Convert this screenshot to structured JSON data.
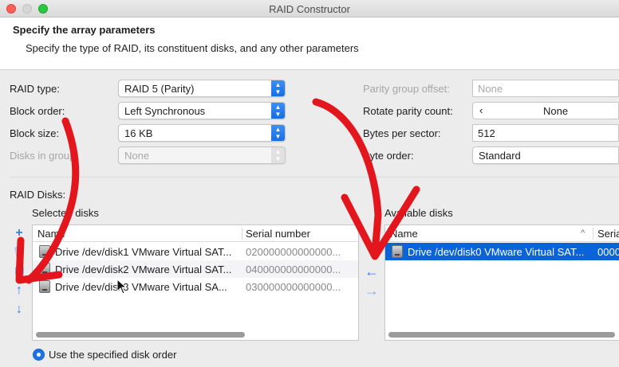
{
  "window": {
    "title": "RAID Constructor"
  },
  "header": {
    "title": "Specify the array parameters",
    "subtitle": "Specify the type of RAID, its constituent disks, and any other parameters"
  },
  "left_params": {
    "raid_type": {
      "label": "RAID type:",
      "value": "RAID 5 (Parity)"
    },
    "block_order": {
      "label": "Block order:",
      "value": "Left Synchronous"
    },
    "block_size": {
      "label": "Block size:",
      "value": "16 KB"
    },
    "disks_in_group": {
      "label": "Disks in group:",
      "value": "None"
    }
  },
  "right_params": {
    "parity_group_offset": {
      "label": "Parity group offset:",
      "value": "None"
    },
    "rotate_parity_count": {
      "label": "Rotate parity count:",
      "value": "None",
      "stepper_glyph": "‹"
    },
    "bytes_per_sector": {
      "label": "Bytes per sector:",
      "value": "512"
    },
    "byte_order": {
      "label": "Byte order:",
      "value": "Standard"
    }
  },
  "raid_disks": {
    "label": "RAID Disks:",
    "selected": {
      "label": "Selected disks",
      "columns": [
        "Name",
        "Serial number"
      ],
      "rows": [
        {
          "name": "Drive /dev/disk1 VMware Virtual SAT...",
          "serial": "020000000000000..."
        },
        {
          "name": "Drive /dev/disk2 VMware Virtual SAT...",
          "serial": "040000000000000..."
        },
        {
          "name": "Drive /dev/disk3 VMware Virtual SA...",
          "serial": "030000000000000..."
        }
      ]
    },
    "available": {
      "label": "Available disks",
      "columns": [
        "Name",
        "Seria"
      ],
      "sort_glyph": "^",
      "rows": [
        {
          "name": "Drive /dev/disk0 VMware Virtual SAT...",
          "serial": "0000"
        }
      ]
    },
    "side_buttons": {
      "add": "+",
      "delete": "🗑",
      "move_up": "↑",
      "move_down": "↓"
    },
    "transfer": {
      "to_selected": "←",
      "to_available": "→"
    }
  },
  "disk_order_option": {
    "label": "Use the specified disk order"
  },
  "colors": {
    "accent": "#1c73e8",
    "selection": "#0a63d8",
    "annotation": "#e2161c"
  }
}
